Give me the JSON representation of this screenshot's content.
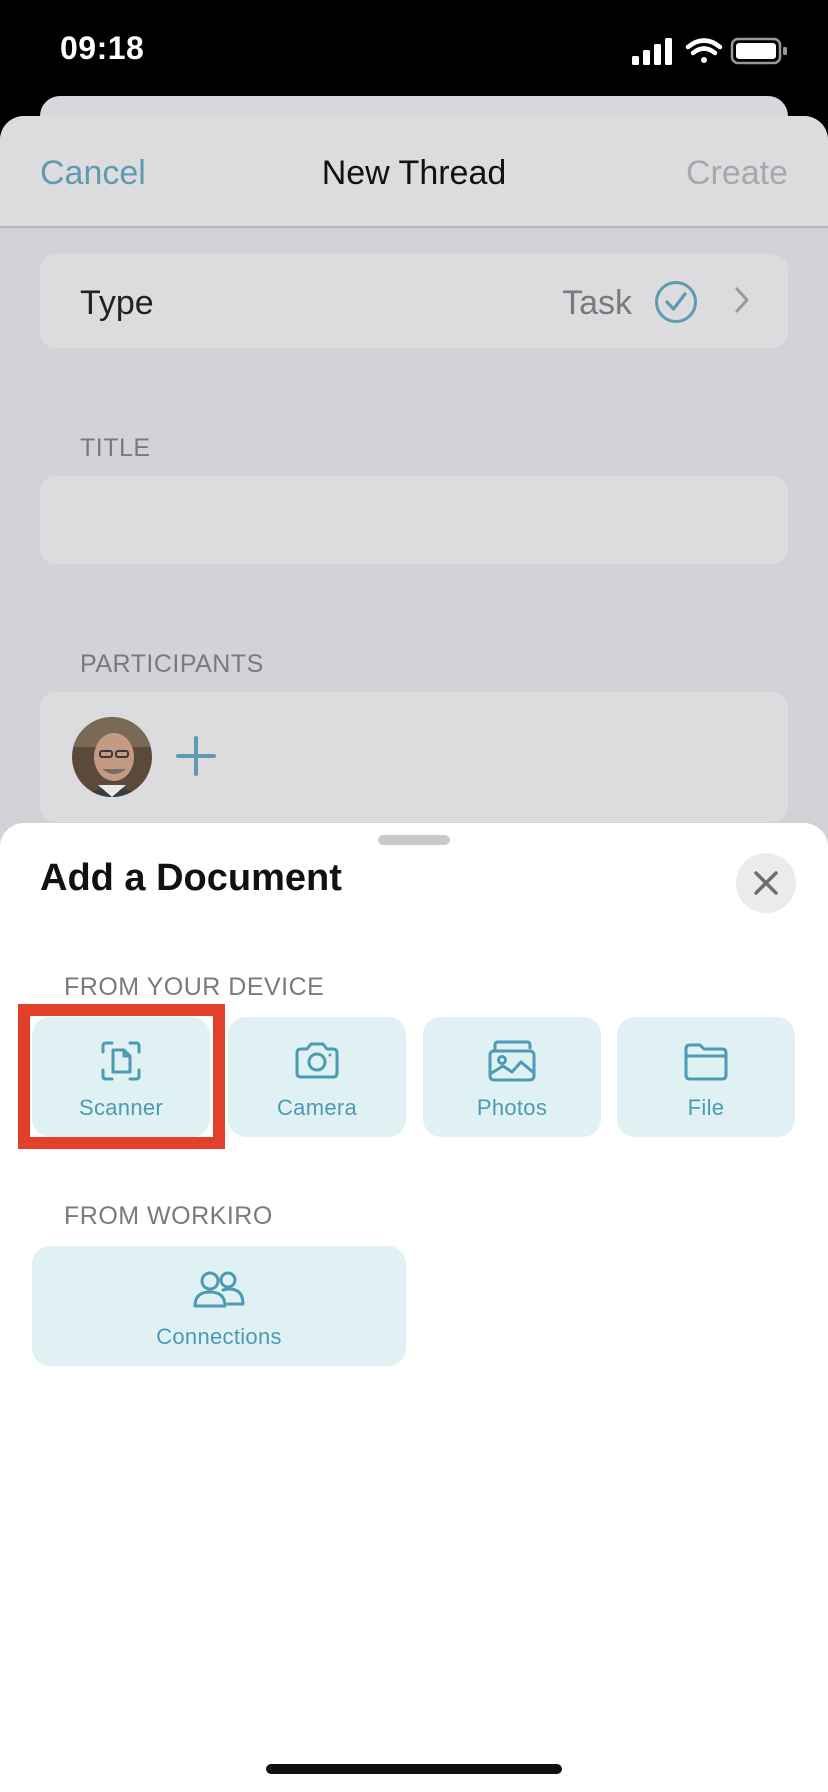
{
  "status_bar": {
    "time": "09:18",
    "icons": [
      "signal-icon",
      "wifi-icon",
      "battery-icon"
    ]
  },
  "nav": {
    "cancel_label": "Cancel",
    "title": "New Thread",
    "create_label": "Create"
  },
  "form": {
    "type_label": "Type",
    "type_value": "Task",
    "title_section": "TITLE",
    "title_value": "",
    "participants_section": "PARTICIPANTS"
  },
  "sheet": {
    "title": "Add a Document",
    "device_section": "FROM YOUR DEVICE",
    "device_options": [
      {
        "label": "Scanner",
        "icon": "scanner-icon"
      },
      {
        "label": "Camera",
        "icon": "camera-icon"
      },
      {
        "label": "Photos",
        "icon": "photos-icon"
      },
      {
        "label": "File",
        "icon": "folder-icon"
      }
    ],
    "workiro_section": "FROM WORKIRO",
    "workiro_options": [
      {
        "label": "Connections",
        "icon": "people-icon"
      }
    ]
  },
  "colors": {
    "accent": "#4c9bb2",
    "tile_bg": "#e0f1f4",
    "highlight": "#e2402a"
  }
}
